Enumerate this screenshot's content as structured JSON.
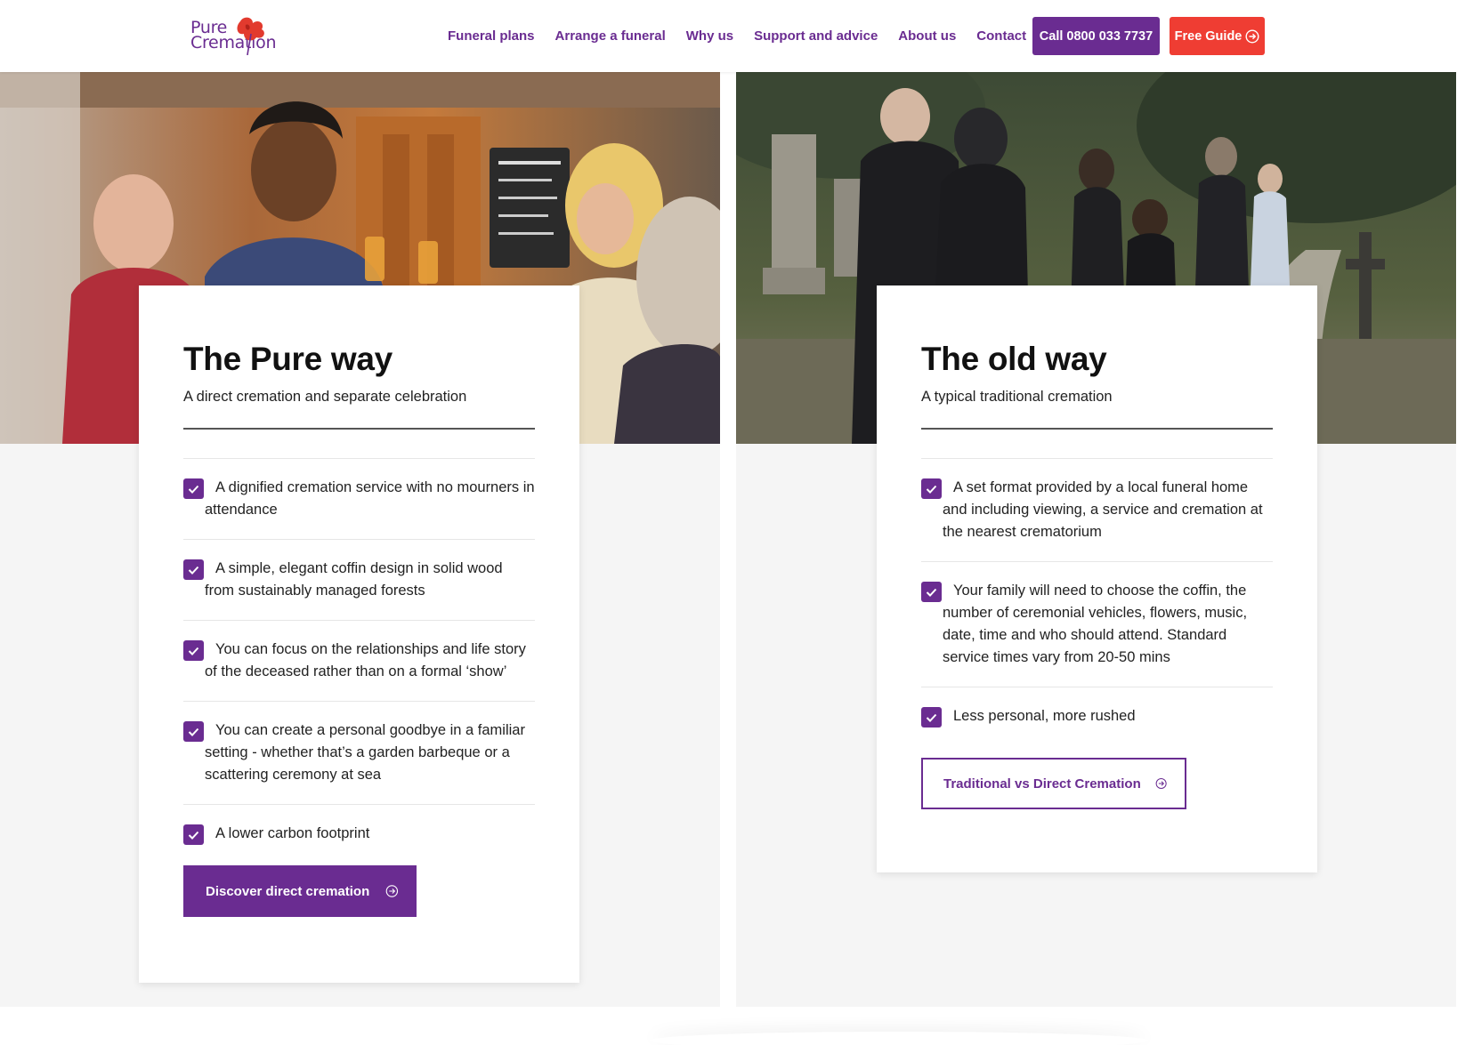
{
  "header": {
    "logo": {
      "line1": "Pure",
      "line2": "Cremation"
    },
    "nav": [
      {
        "label": "Funeral plans"
      },
      {
        "label": "Arrange a funeral"
      },
      {
        "label": "Why us"
      },
      {
        "label": "Support and advice"
      },
      {
        "label": "About us"
      },
      {
        "label": "Contact"
      }
    ],
    "call_label": "Call 0800 033 7737",
    "guide_label": "Free Guide"
  },
  "pure": {
    "title": "The Pure way",
    "subtitle": "A direct cremation and separate celebration",
    "items": [
      "A dignified cremation service with no mourners in attendance",
      "A simple, elegant coffin design in solid wood from sustainably managed forests",
      "You can focus on the relationships and life story of the deceased rather than on a formal ‘show’",
      "You can create a personal goodbye in a familiar setting - whether that’s a garden barbeque or a scattering ceremony at sea",
      "A lower carbon footprint"
    ],
    "button_label": "Discover direct cremation"
  },
  "old": {
    "title": "The old way",
    "subtitle": "A typical traditional cremation",
    "items": [
      "A set format provided by a local funeral home and including viewing, a service and cremation at the nearest crematorium",
      "Your family will need to choose the coffin, the number of ceremonial vehicles, flowers, music, date, time and who should attend. Standard service times vary from 20-50 mins",
      "Less personal, more rushed"
    ],
    "button_label": "Traditional vs Direct Cremation"
  },
  "colors": {
    "brand_purple": "#6a2c91",
    "accent_red": "#ef3d33",
    "panel_bg": "#f5f5f5"
  }
}
